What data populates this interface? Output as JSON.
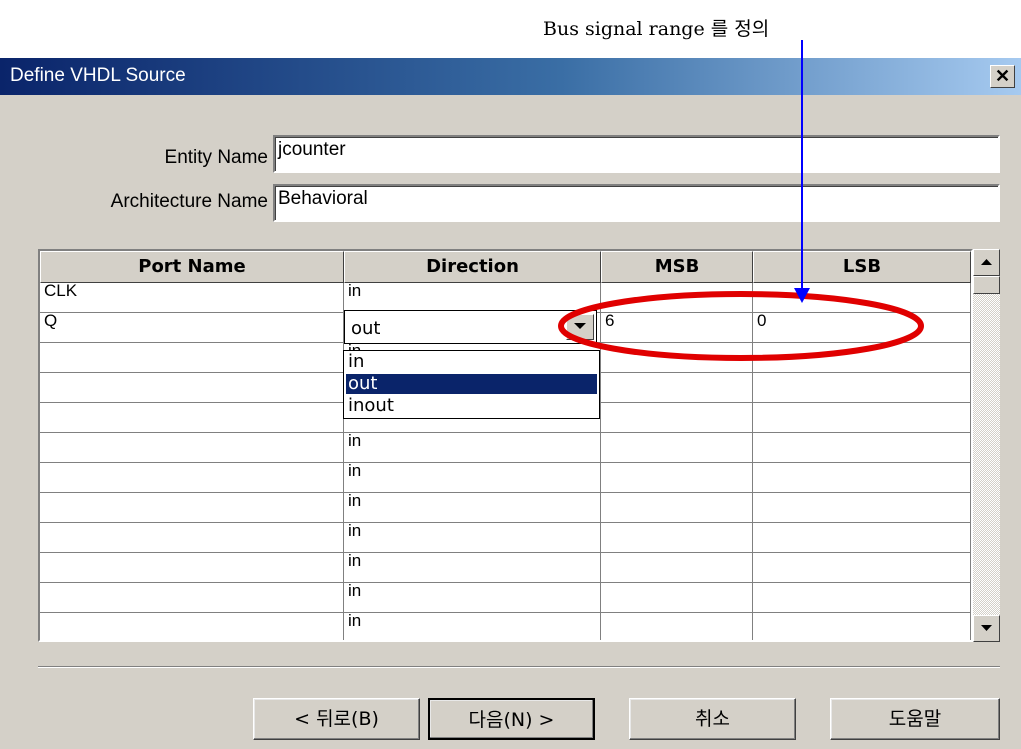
{
  "annotation": {
    "text": "Bus signal range 를 정의",
    "arrow_color": "#0000ff",
    "ellipse_color": "#e00000"
  },
  "window": {
    "title": "Define VHDL Source",
    "close_glyph": "✕"
  },
  "form": {
    "entity_label": "Entity Name",
    "entity_value": "jcounter",
    "architecture_label": "Architecture Name",
    "architecture_value": "Behavioral"
  },
  "grid": {
    "columns": [
      "Port Name",
      "Direction",
      "MSB",
      "LSB"
    ],
    "rows": [
      {
        "port": "CLK",
        "direction": "in",
        "msb": "",
        "lsb": ""
      },
      {
        "port": "Q",
        "direction": "out",
        "msb": "6",
        "lsb": "0"
      },
      {
        "port": "",
        "direction": "in",
        "msb": "",
        "lsb": ""
      },
      {
        "port": "",
        "direction": "in",
        "msb": "",
        "lsb": ""
      },
      {
        "port": "",
        "direction": "in",
        "msb": "",
        "lsb": ""
      },
      {
        "port": "",
        "direction": "in",
        "msb": "",
        "lsb": ""
      },
      {
        "port": "",
        "direction": "in",
        "msb": "",
        "lsb": ""
      },
      {
        "port": "",
        "direction": "in",
        "msb": "",
        "lsb": ""
      },
      {
        "port": "",
        "direction": "in",
        "msb": "",
        "lsb": ""
      },
      {
        "port": "",
        "direction": "in",
        "msb": "",
        "lsb": ""
      },
      {
        "port": "",
        "direction": "in",
        "msb": "",
        "lsb": ""
      },
      {
        "port": "",
        "direction": "in",
        "msb": "",
        "lsb": ""
      }
    ],
    "combo_value": "out",
    "dropdown_options": [
      "in",
      "out",
      "inout"
    ],
    "dropdown_selected": "out"
  },
  "buttons": {
    "back": "< 뒤로(B)",
    "next": "다음(N) >",
    "cancel": "취소",
    "help": "도움말"
  },
  "colors": {
    "titlebar_start": "#0a246a",
    "titlebar_end": "#a6caf0",
    "dialog_bg": "#d4d0c8",
    "selection": "#0a246a"
  }
}
